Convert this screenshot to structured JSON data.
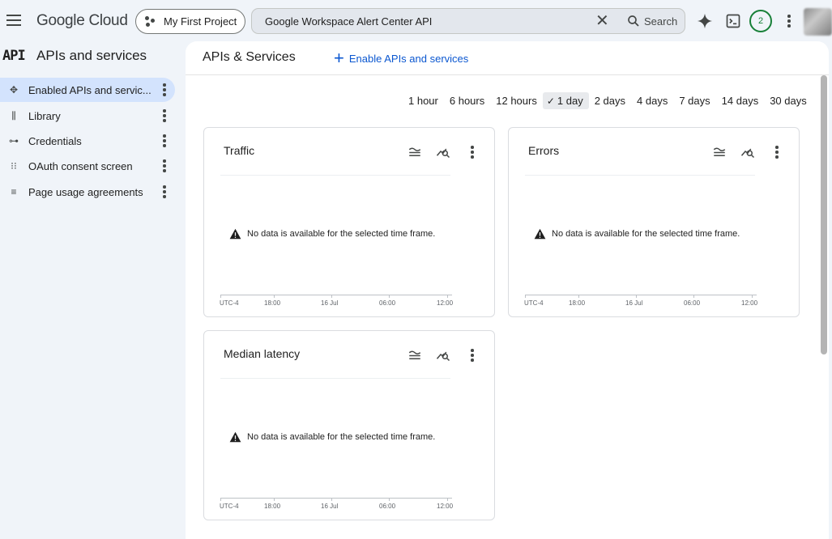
{
  "topbar": {
    "brand": "Google Cloud",
    "project_label": "My First Project",
    "search_value": "Google Workspace Alert Center API",
    "search_button": "Search",
    "notification_count": "2"
  },
  "sidebar": {
    "logo": "API",
    "title": "APIs and services",
    "items": [
      {
        "label": "Enabled APIs and servic...",
        "icon": "api-hub-icon",
        "active": true
      },
      {
        "label": "Library",
        "icon": "library-icon"
      },
      {
        "label": "Credentials",
        "icon": "key-icon"
      },
      {
        "label": "OAuth consent screen",
        "icon": "consent-icon"
      },
      {
        "label": "Page usage agreements",
        "icon": "settings-list-icon"
      }
    ]
  },
  "main": {
    "title": "APIs & Services",
    "enable_button": "Enable APIs and services",
    "time_ranges": [
      "1 hour",
      "6 hours",
      "12 hours",
      "1 day",
      "2 days",
      "4 days",
      "7 days",
      "14 days",
      "30 days"
    ],
    "selected_range": "1 day",
    "cards": [
      {
        "title": "Traffic",
        "message": "No data is available for the selected time frame.",
        "axis": [
          "UTC-4",
          "18:00",
          "16 Jul",
          "06:00",
          "12:00"
        ]
      },
      {
        "title": "Errors",
        "message": "No data is available for the selected time frame.",
        "axis": [
          "UTC-4",
          "18:00",
          "16 Jul",
          "06:00",
          "12:00"
        ]
      },
      {
        "title": "Median latency",
        "message": "No data is available for the selected time frame.",
        "axis": [
          "UTC-4",
          "18:00",
          "16 Jul",
          "06:00",
          "12:00"
        ]
      }
    ]
  },
  "colors": {
    "accent": "#0b57d0",
    "active_nav": "#d3e3fd",
    "avatar_ring": "#188038"
  }
}
